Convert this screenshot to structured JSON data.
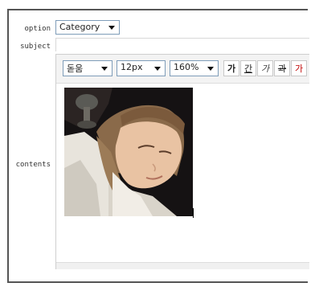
{
  "form": {
    "option_label": "option",
    "subject_label": "subject",
    "contents_label": "contents",
    "category_value": "Category",
    "subject_value": ""
  },
  "toolbar": {
    "font_value": "돋움",
    "size_value": "12px",
    "line_height_value": "160%",
    "bold_label": "가",
    "underline_label": "간",
    "italic_label": "가",
    "strike_label": "과",
    "color_label": "가",
    "accent_color": "#c00000"
  },
  "content": {
    "image_alt": "Photo of a long-haired man sleeping"
  }
}
